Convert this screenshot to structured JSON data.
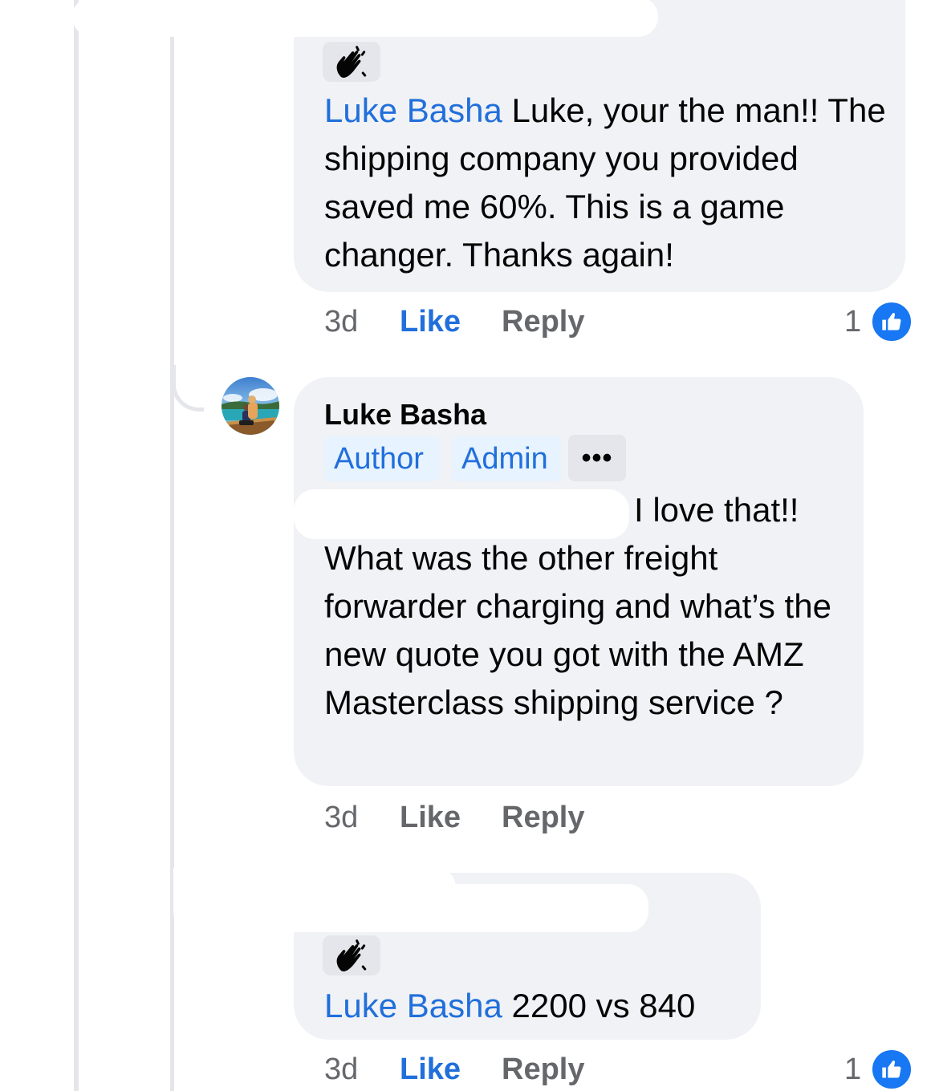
{
  "comments": [
    {
      "mention": "Luke Basha",
      "text": " Luke, your the man!! The shipping company you provided saved me 60%. This is a game changer. Thanks again!",
      "time": "3d",
      "like_label": "Like",
      "reply_label": "Reply",
      "reaction_count": "1",
      "liked": true
    },
    {
      "author": "Luke Basha",
      "badges": [
        "Author",
        "Admin"
      ],
      "more_label": "•••",
      "first_line": "I love that!!",
      "text": "What was the other freight forwarder charging and what’s the new quote you got with the AMZ Masterclass shipping service ?",
      "time": "3d",
      "like_label": "Like",
      "reply_label": "Reply",
      "liked": false
    },
    {
      "mention": "Luke Basha",
      "text": " 2200 vs 840",
      "time": "3d",
      "like_label": "Like",
      "reply_label": "Reply",
      "reaction_count": "1",
      "liked": true
    }
  ],
  "icons": {
    "wave": "waving-hand-icon",
    "like": "thumbs-up-icon",
    "avatar": "profile-photo"
  },
  "colors": {
    "mention": "#216fdb",
    "bubble": "#f0f2f5",
    "like_active": "#1877f2",
    "muted": "#65676b"
  }
}
